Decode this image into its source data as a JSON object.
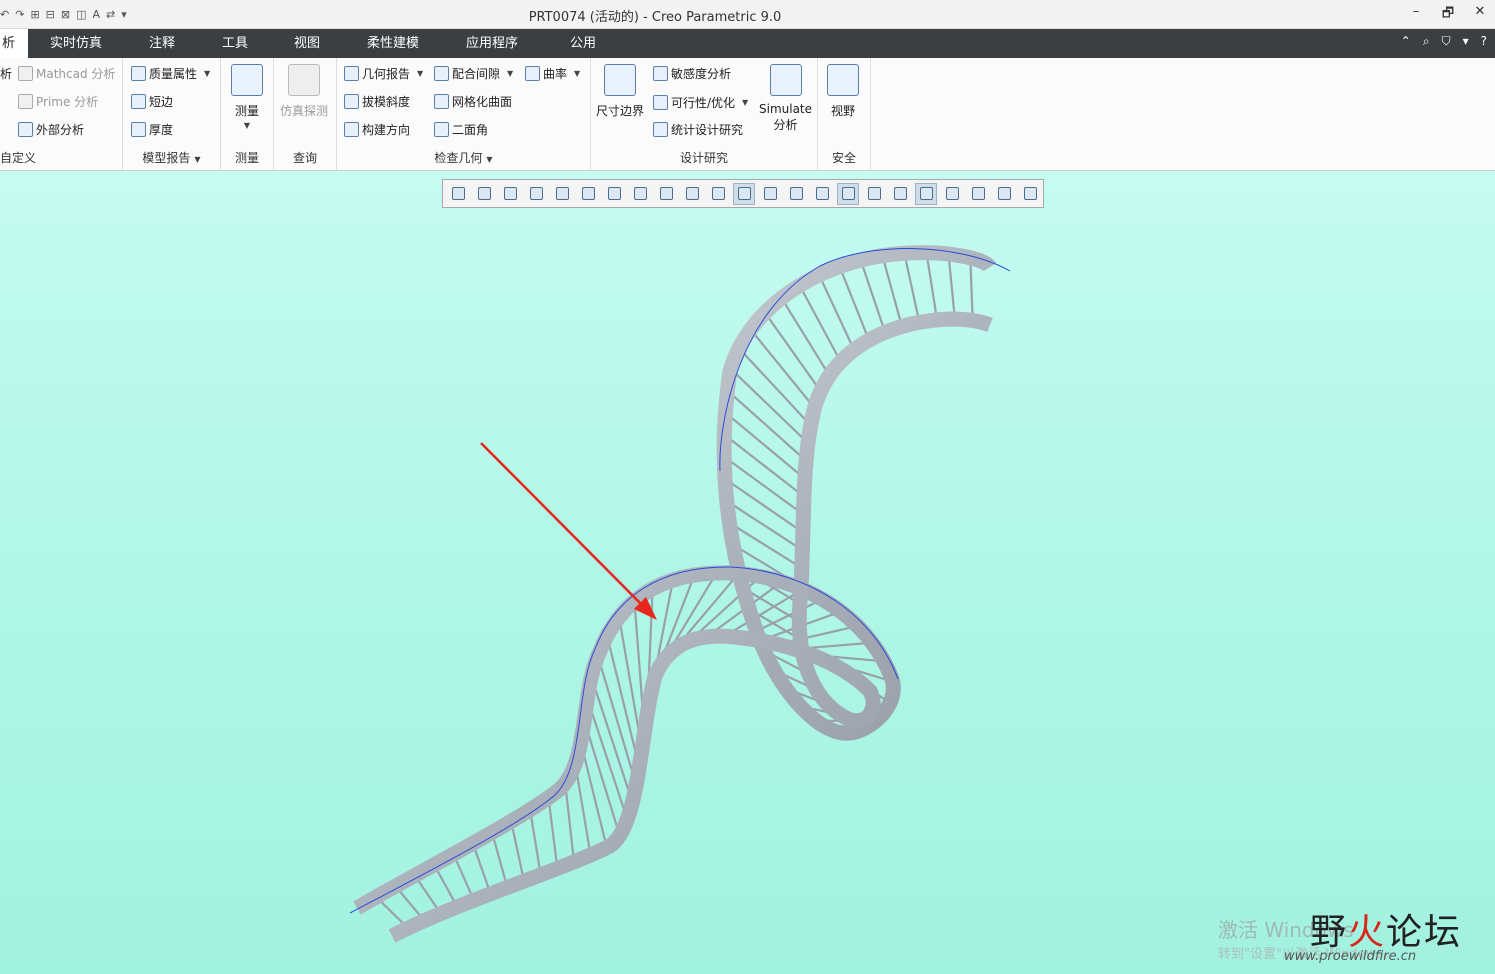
{
  "window": {
    "title": "PRT0074 (活动的) - Creo Parametric 9.0",
    "controls": [
      "–",
      "🗗",
      "✕"
    ]
  },
  "quick_access": {
    "items": [
      "↶",
      "↷",
      "⊞",
      "⊟",
      "⊠",
      "◫",
      "A",
      "⇄",
      "▾"
    ]
  },
  "tabs": [
    {
      "label": "析",
      "active": true
    },
    {
      "label": "实时仿真"
    },
    {
      "label": "注释"
    },
    {
      "label": "工具"
    },
    {
      "label": "视图"
    },
    {
      "label": "柔性建模"
    },
    {
      "label": "应用程序"
    },
    {
      "label": "公用"
    }
  ],
  "tab_right_icons": [
    "⌃",
    "⌕",
    "⛉",
    "▾",
    "?"
  ],
  "ribbon": {
    "custom": {
      "label": "自定义",
      "items": [
        "Mathcad 分析",
        "Prime 分析",
        "外部分析"
      ],
      "cut_text": "析"
    },
    "model_report": {
      "label": "模型报告",
      "items": [
        "质量属性",
        "短边",
        "厚度"
      ]
    },
    "measure": {
      "label": "测量",
      "button": "测量"
    },
    "query": {
      "label": "查询",
      "button": "仿真探测"
    },
    "inspect_geometry": {
      "label": "检查几何",
      "items": [
        "几何报告",
        "配合间隙",
        "曲率",
        "拔模斜度",
        "网格化曲面",
        "构建方向",
        "二面角"
      ]
    },
    "design_study": {
      "label": "设计研究",
      "dim_button": "尺寸边界",
      "items": [
        "敏感度分析",
        "可行性/优化",
        "统计设计研究"
      ],
      "simulate_line1": "Simulate",
      "simulate_line2": "分析"
    },
    "safety": {
      "label": "安全",
      "button": "视野"
    }
  },
  "graphics_toolbar": {
    "button_count": 23,
    "active_indices": [
      11,
      15,
      18
    ]
  },
  "watermark": {
    "line1": "激活 Windows",
    "line2": "转到\"设置\"以激活 Windows。"
  },
  "forum_logo": {
    "part1": "野",
    "part2": "火",
    "part3": "论坛",
    "url": "www.proewildfire.cn"
  },
  "colors": {
    "tab_bar": "#3b3f42",
    "viewport_top": "#c6fbf2",
    "viewport_bottom": "#a2f2e0",
    "arrow": "#e8261b",
    "model": "#b9bec6"
  }
}
